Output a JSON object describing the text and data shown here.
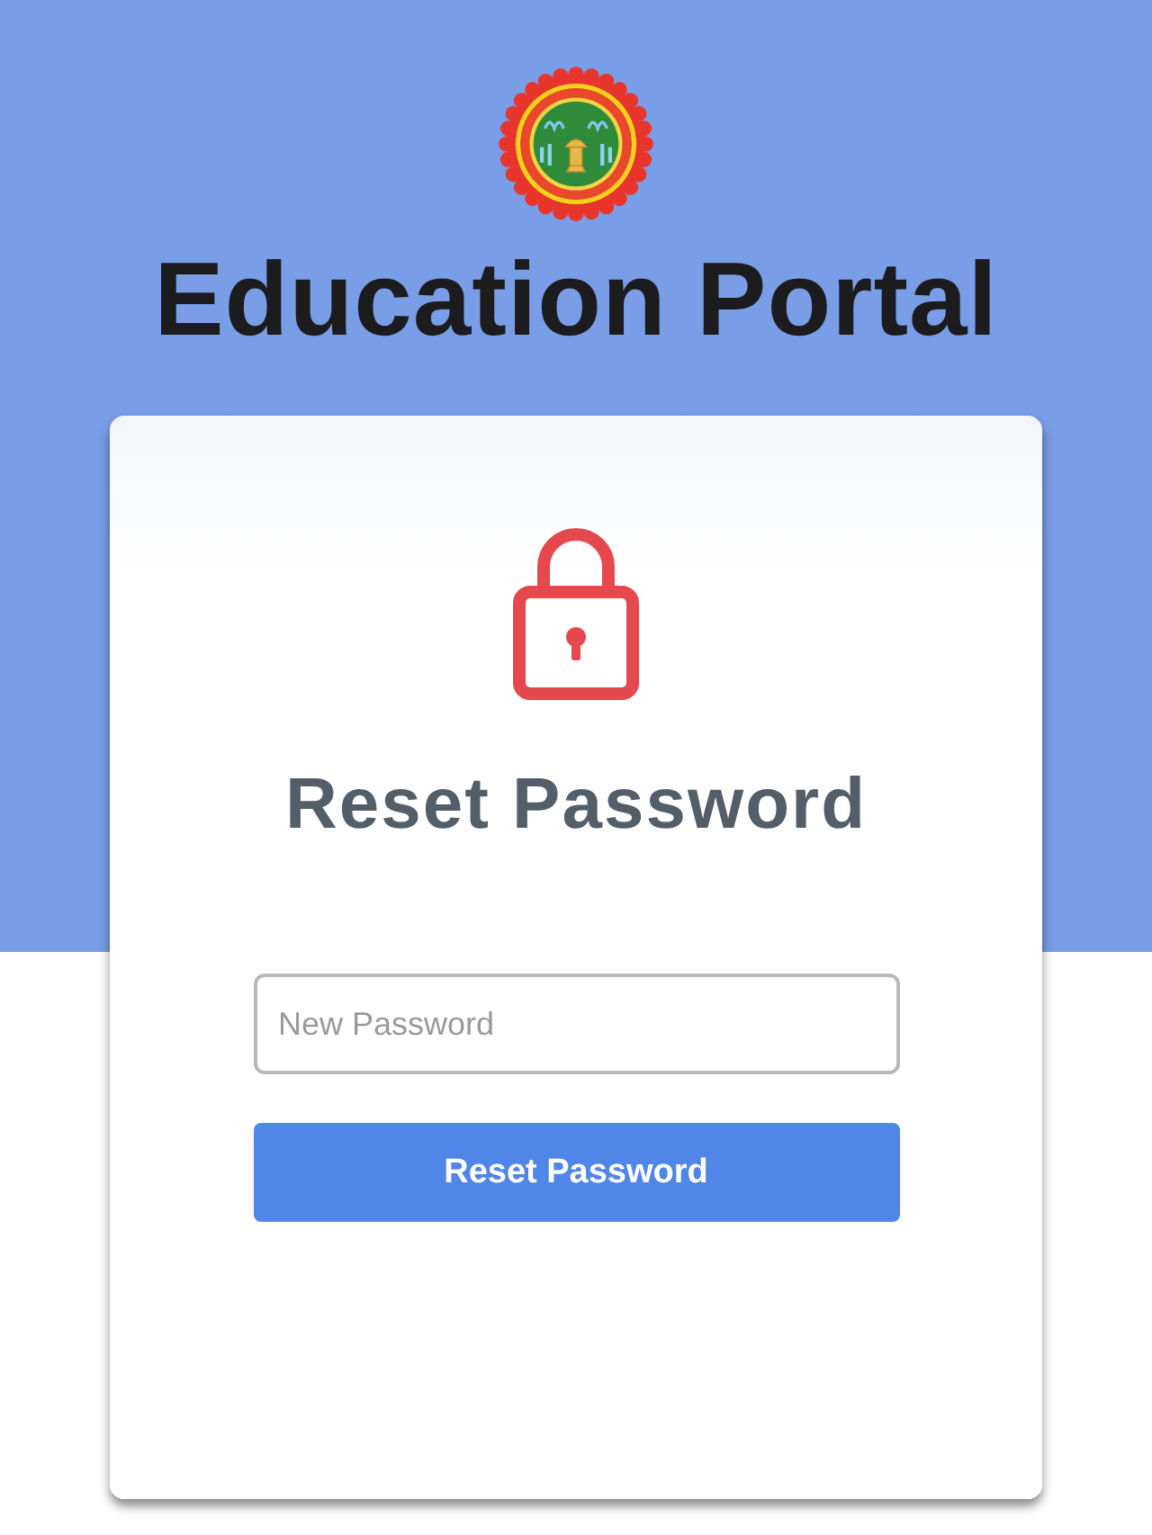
{
  "header": {
    "title": "Education Portal"
  },
  "card": {
    "heading": "Reset Password",
    "password_field": {
      "placeholder": "New Password"
    },
    "submit_button": {
      "label": "Reset Password"
    }
  }
}
